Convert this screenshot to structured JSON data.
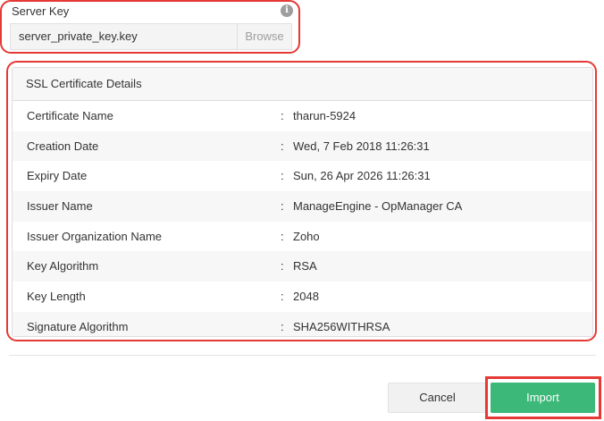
{
  "server_key": {
    "label": "Server Key",
    "info_icon": "info-icon",
    "info_glyph": "i",
    "file_value": "server_private_key.key",
    "browse_label": "Browse"
  },
  "ssl": {
    "title": "SSL Certificate Details",
    "separator": ":",
    "rows": [
      {
        "key": "Certificate Name",
        "value": "tharun-5924"
      },
      {
        "key": "Creation Date",
        "value": "Wed, 7 Feb 2018 11:26:31"
      },
      {
        "key": "Expiry Date",
        "value": "Sun, 26 Apr 2026 11:26:31"
      },
      {
        "key": "Issuer Name",
        "value": "ManageEngine - OpManager CA"
      },
      {
        "key": "Issuer Organization Name",
        "value": "Zoho"
      },
      {
        "key": "Key Algorithm",
        "value": "RSA"
      },
      {
        "key": "Key Length",
        "value": "2048"
      },
      {
        "key": "Signature Algorithm",
        "value": "SHA256WITHRSA"
      }
    ]
  },
  "actions": {
    "cancel_label": "Cancel",
    "import_label": "Import"
  },
  "colors": {
    "highlight_outline": "#e53935",
    "import_green": "#3cb878",
    "alt_row": "#f7f7f7"
  }
}
